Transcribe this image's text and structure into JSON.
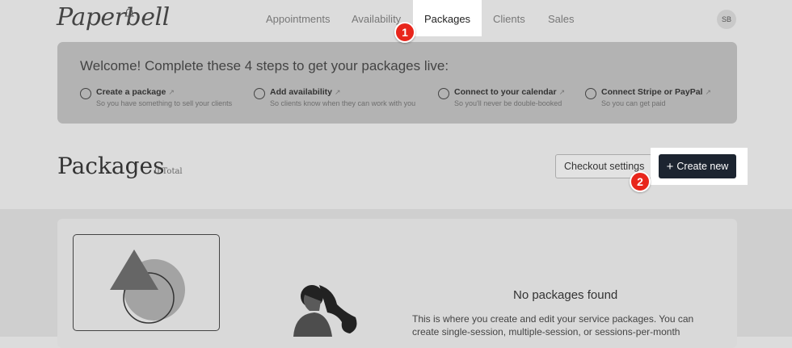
{
  "app": {
    "logo": "Paperbell"
  },
  "nav": {
    "items": [
      "Appointments",
      "Availability",
      "Packages",
      "Clients",
      "Sales"
    ],
    "active": "Packages",
    "avatar_initials": "SB"
  },
  "badges": [
    "1",
    "2"
  ],
  "welcome": {
    "title": "Welcome! Complete these 4 steps to get your packages live:",
    "steps": [
      {
        "title": "Create a package",
        "subtitle": "So you have something to sell your clients"
      },
      {
        "title": "Add availability",
        "subtitle": "So clients know when they can work with you"
      },
      {
        "title": "Connect to your calendar",
        "subtitle": "So you'll never be double-booked"
      },
      {
        "title": "Connect Stripe or PayPal",
        "subtitle": "So you can get paid"
      }
    ]
  },
  "packages": {
    "title": "Packages",
    "total": "0 Total",
    "checkout_label": "Checkout settings",
    "create_label": "Create new"
  },
  "empty": {
    "title": "No packages found",
    "description": "This is where you create and edit your service packages. You can create single-session, multiple-session, or sessions-per-month"
  },
  "icons": {
    "external": "external-link-icon",
    "plus": "plus-icon",
    "bell": "bell-icon"
  },
  "colors": {
    "primary_button": "#1c2430",
    "badge": "#e8261c",
    "card_overlay": "#b3b3b3"
  }
}
